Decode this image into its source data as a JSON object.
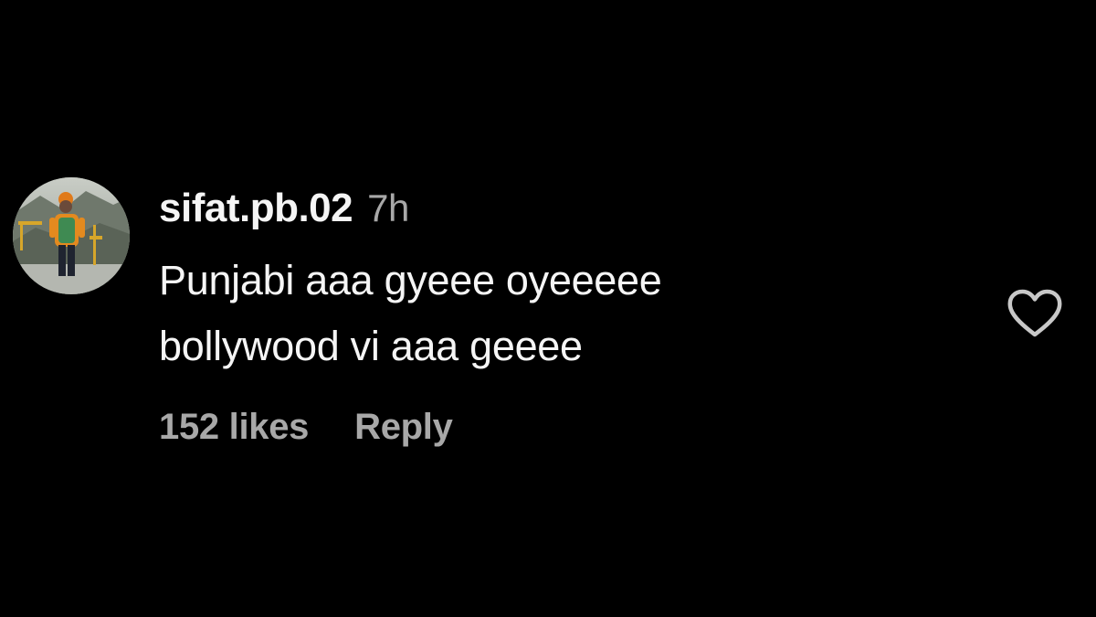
{
  "comment": {
    "username": "sifat.pb.02",
    "timestamp": "7h",
    "text_lines": [
      "Punjabi aaa gyeee oyeeeee",
      "bollywood vi aaa geeee"
    ],
    "likes_label": "152 likes",
    "reply_label": "Reply",
    "like_icon": "heart-outline-icon",
    "avatar_icon": "user-avatar-photo"
  },
  "colors": {
    "background": "#000000",
    "primary_text": "#f5f5f5",
    "secondary_text": "#a8a8a8",
    "icon_stroke": "#c8c8c8"
  }
}
